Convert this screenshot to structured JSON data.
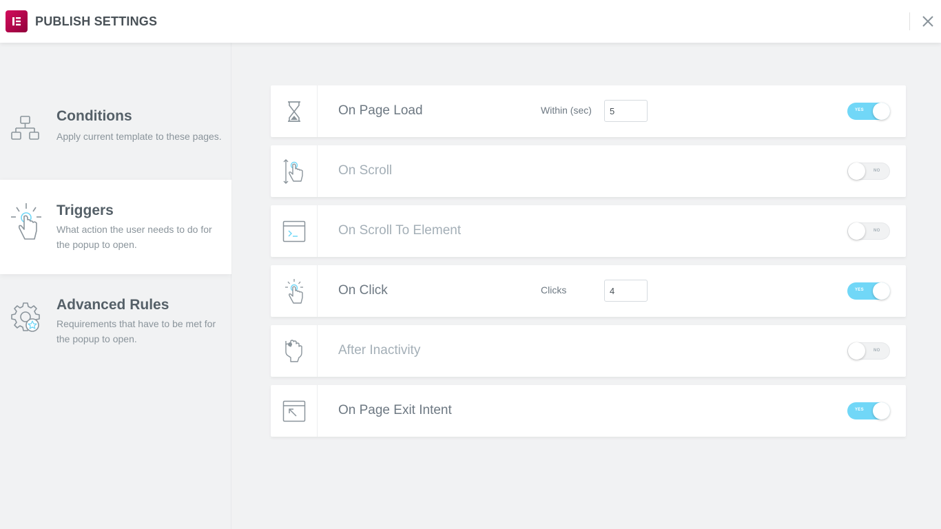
{
  "header": {
    "title": "PUBLISH SETTINGS",
    "logo_icon": "elementor-logo-icon",
    "close_icon": "close-icon"
  },
  "sidebar": {
    "items": [
      {
        "name": "Conditions",
        "description": "Apply current template to these pages.",
        "icon": "sitemap-icon",
        "active": false
      },
      {
        "name": "Triggers",
        "description": "What action the user needs to do for the popup to open.",
        "icon": "tap-icon",
        "active": true
      },
      {
        "name": "Advanced Rules",
        "description": "Requirements that have to be met for the popup to open.",
        "icon": "gear-star-icon",
        "active": false
      }
    ]
  },
  "triggers": [
    {
      "label": "On Page Load",
      "icon": "hourglass-icon",
      "enabled": true,
      "toggle_text": "YES",
      "field_label": "Within (sec)",
      "field_value": "5"
    },
    {
      "label": "On Scroll",
      "icon": "scroll-hand-icon",
      "enabled": false,
      "toggle_text": "NO"
    },
    {
      "label": "On Scroll To Element",
      "icon": "terminal-window-icon",
      "enabled": false,
      "toggle_text": "NO"
    },
    {
      "label": "On Click",
      "icon": "click-hand-icon",
      "enabled": true,
      "toggle_text": "YES",
      "field_label": "Clicks",
      "field_value": "4"
    },
    {
      "label": "After Inactivity",
      "icon": "inactivity-hand-icon",
      "enabled": false,
      "toggle_text": "NO"
    },
    {
      "label": "On Page Exit Intent",
      "icon": "exit-window-icon",
      "enabled": true,
      "toggle_text": "YES"
    }
  ],
  "colors": {
    "accent": "#71d7f7",
    "brand": "#92003b",
    "text": "#6d7882"
  }
}
